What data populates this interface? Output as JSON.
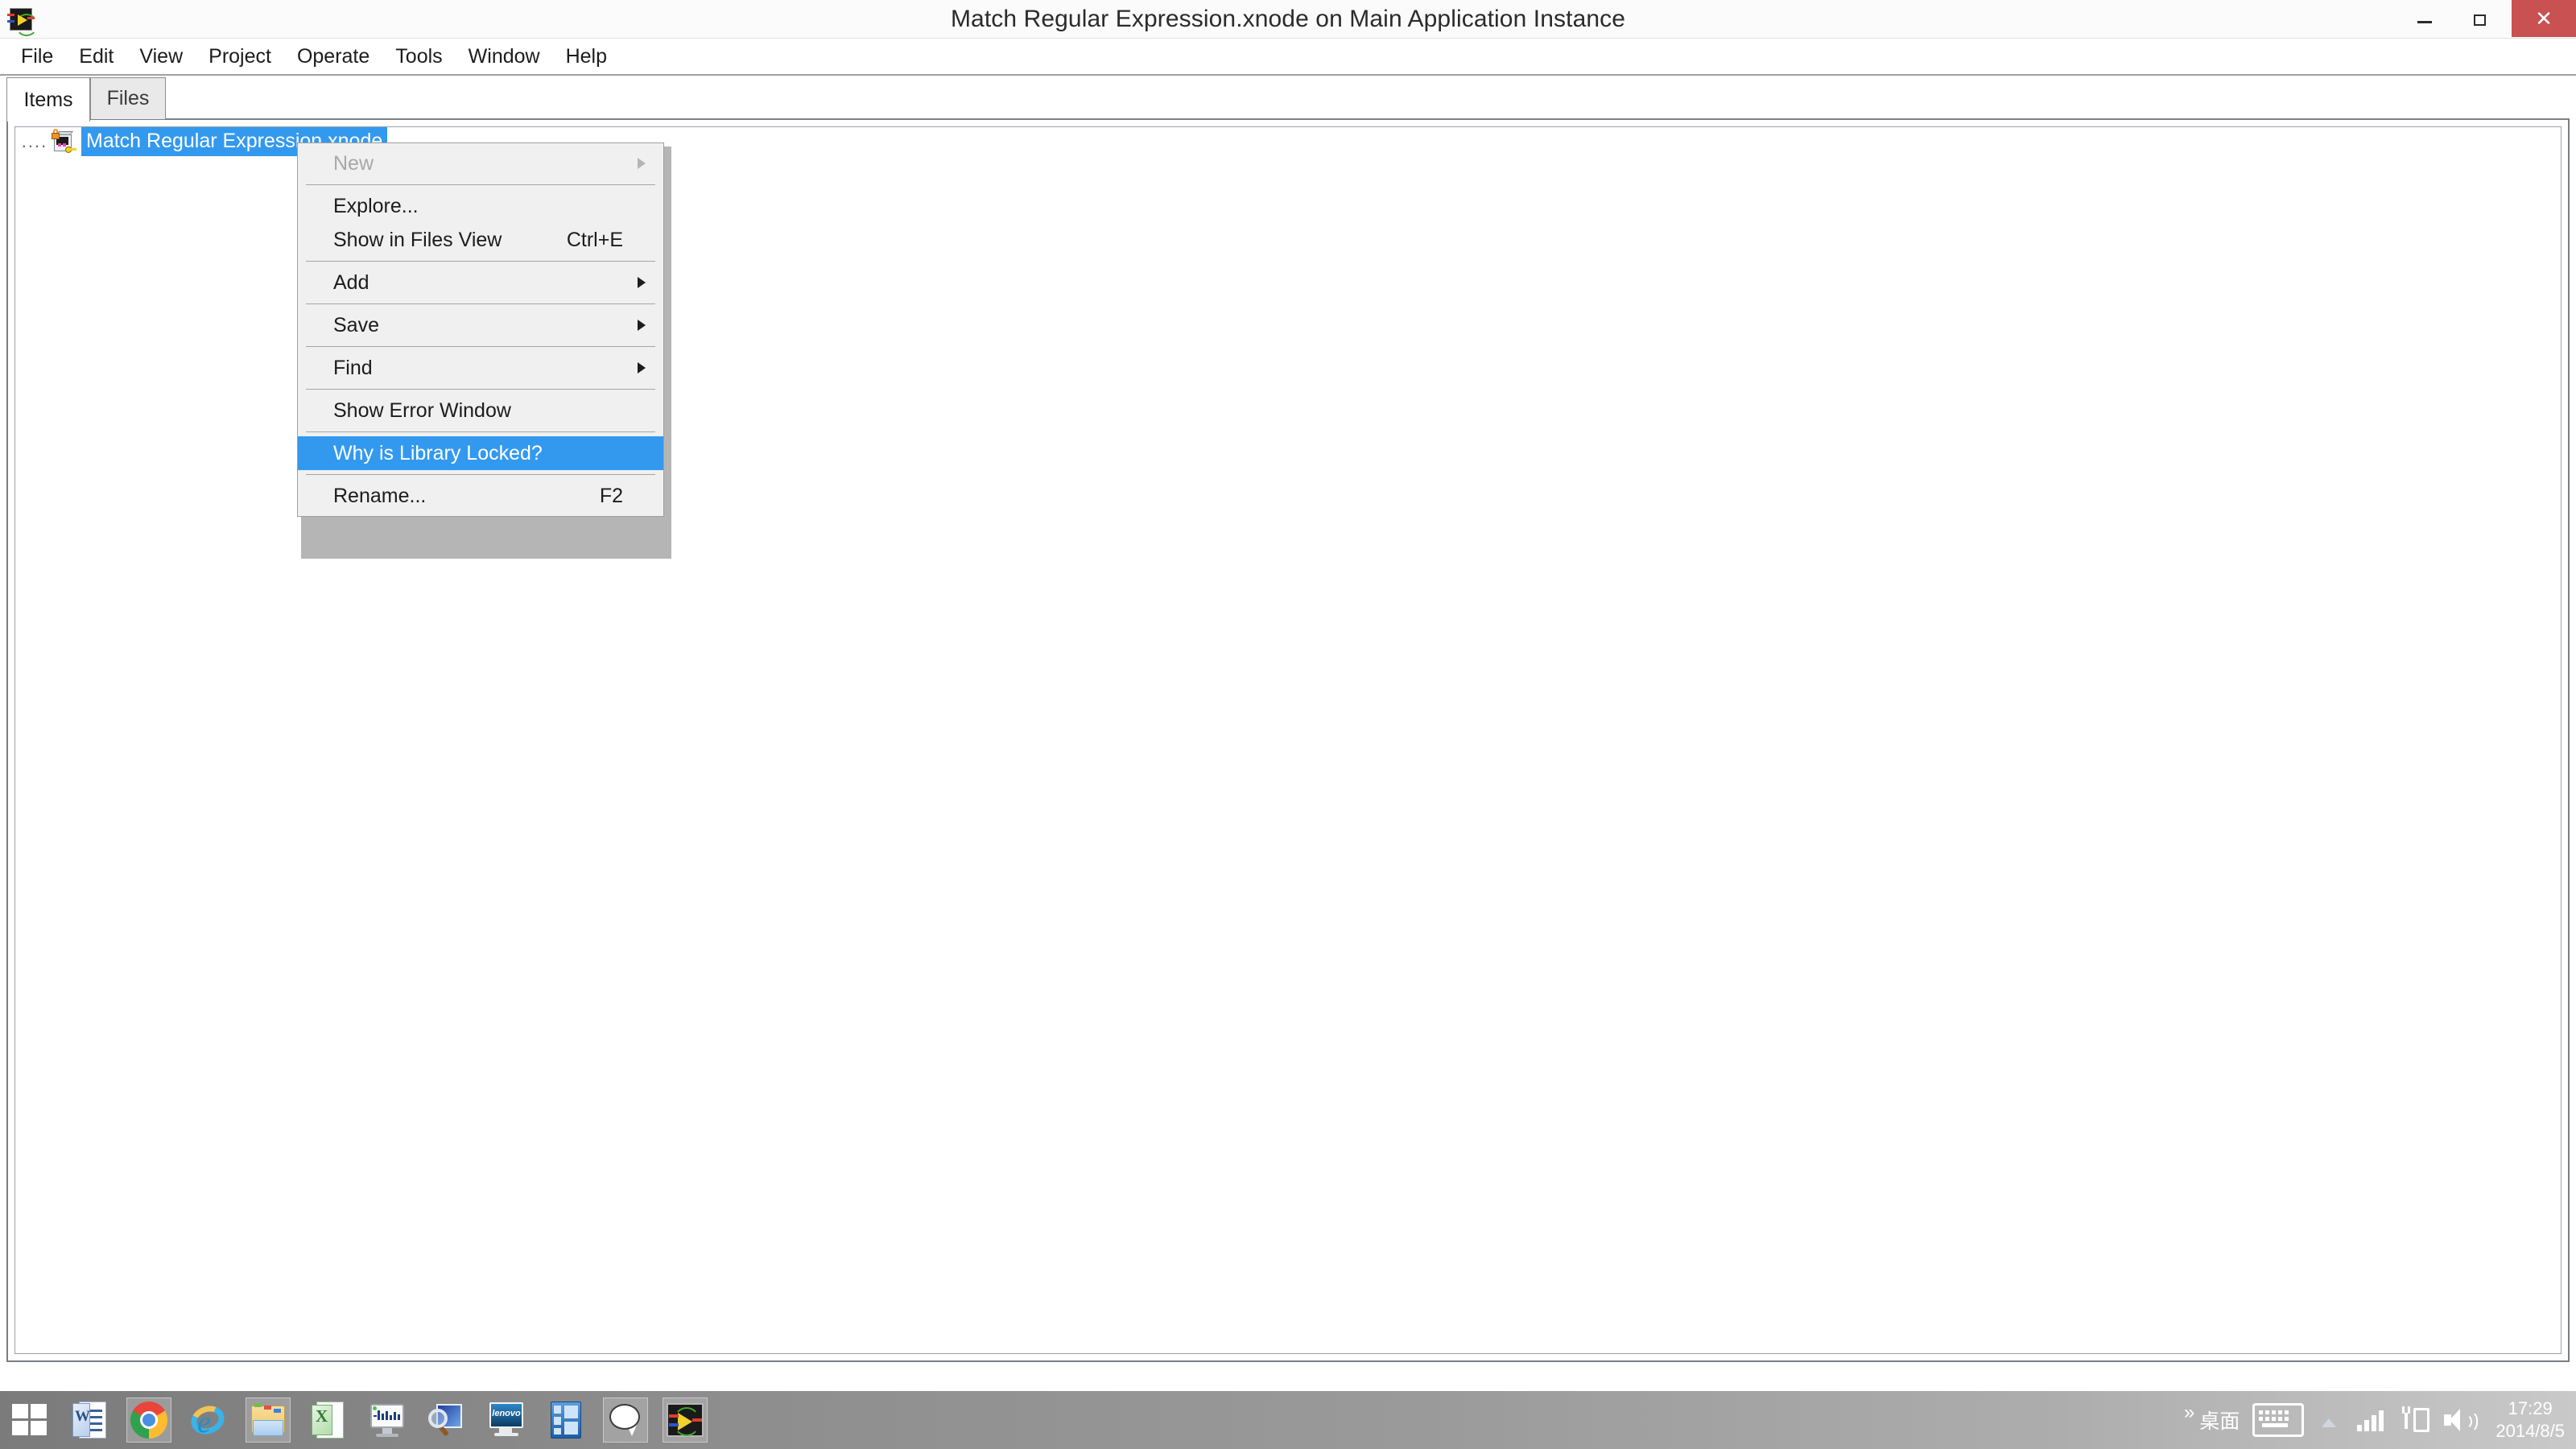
{
  "window": {
    "title": "Match Regular Expression.xnode on Main Application Instance",
    "app_icon": "labview-icon",
    "controls": {
      "minimize": "minimize-icon",
      "maximize": "restore-icon",
      "close": "close-icon"
    }
  },
  "menubar": {
    "items": [
      {
        "label": "File"
      },
      {
        "label": "Edit"
      },
      {
        "label": "View"
      },
      {
        "label": "Project"
      },
      {
        "label": "Operate"
      },
      {
        "label": "Tools"
      },
      {
        "label": "Window"
      },
      {
        "label": "Help"
      }
    ]
  },
  "tabs": [
    {
      "label": "Items",
      "active": true
    },
    {
      "label": "Files",
      "active": false
    }
  ],
  "tree": {
    "expander": "....",
    "icon": "locked-xnode-icon",
    "selected_item_label": "Match Regular Expression.xnode",
    "selected": true
  },
  "context_menu": {
    "items": [
      {
        "label": "New",
        "shortcut": "",
        "submenu": true,
        "disabled": true,
        "highlight": false
      },
      {
        "separator": true
      },
      {
        "label": "Explore...",
        "shortcut": "",
        "submenu": false,
        "disabled": false,
        "highlight": false
      },
      {
        "label": "Show in Files View",
        "shortcut": "Ctrl+E",
        "submenu": false,
        "disabled": false,
        "highlight": false
      },
      {
        "separator": true
      },
      {
        "label": "Add",
        "shortcut": "",
        "submenu": true,
        "disabled": false,
        "highlight": false
      },
      {
        "separator": true
      },
      {
        "label": "Save",
        "shortcut": "",
        "submenu": true,
        "disabled": false,
        "highlight": false
      },
      {
        "separator": true
      },
      {
        "label": "Find",
        "shortcut": "",
        "submenu": true,
        "disabled": false,
        "highlight": false
      },
      {
        "separator": true
      },
      {
        "label": "Show Error Window",
        "shortcut": "",
        "submenu": false,
        "disabled": false,
        "highlight": false
      },
      {
        "separator": true
      },
      {
        "label": "Why is Library Locked?",
        "shortcut": "",
        "submenu": false,
        "disabled": false,
        "highlight": true
      },
      {
        "separator": true
      },
      {
        "label": "Rename...",
        "shortcut": "F2",
        "submenu": false,
        "disabled": false,
        "highlight": false
      }
    ]
  },
  "taskbar": {
    "buttons": [
      {
        "name": "start-button",
        "icon": "windows-start-icon",
        "boxed": false
      },
      {
        "name": "word-taskbar-button",
        "icon": "word-icon",
        "boxed": false
      },
      {
        "name": "chrome-taskbar-button",
        "icon": "chrome-icon",
        "boxed": true
      },
      {
        "name": "ie-taskbar-button",
        "icon": "internet-explorer-icon",
        "boxed": false
      },
      {
        "name": "explorer-taskbar-button",
        "icon": "folder-icon",
        "boxed": true
      },
      {
        "name": "excel-taskbar-button",
        "icon": "excel-icon",
        "boxed": false
      },
      {
        "name": "measurement-taskbar-button",
        "icon": "monitor-waveform-icon",
        "boxed": false
      },
      {
        "name": "image-viewer-taskbar-button",
        "icon": "magnifier-image-icon",
        "boxed": false
      },
      {
        "name": "lenovo-taskbar-button",
        "icon": "lenovo-icon",
        "boxed": false
      },
      {
        "name": "media-taskbar-button",
        "icon": "film-strip-icon",
        "boxed": false
      },
      {
        "name": "chat-taskbar-button",
        "icon": "speech-bubble-icon",
        "boxed": true
      },
      {
        "name": "labview-taskbar-button",
        "icon": "labview-icon",
        "boxed": true
      }
    ],
    "tray": {
      "overflow_chevron": "»",
      "desktop_label": "桌面",
      "ime_icon": "keyboard-icon",
      "show_hidden_icon": "show-hidden-icons-arrow",
      "network_icon": "signal-bars-icon",
      "battery_icon": "battery-charging-icon",
      "volume_icon": "volume-icon",
      "time": "17:29",
      "date": "2014/8/5"
    }
  },
  "colors": {
    "accent_selection": "#3399ef",
    "close_button": "#c95151",
    "menu_bg": "#f0f0f0",
    "panel_border": "#7b7f87"
  }
}
